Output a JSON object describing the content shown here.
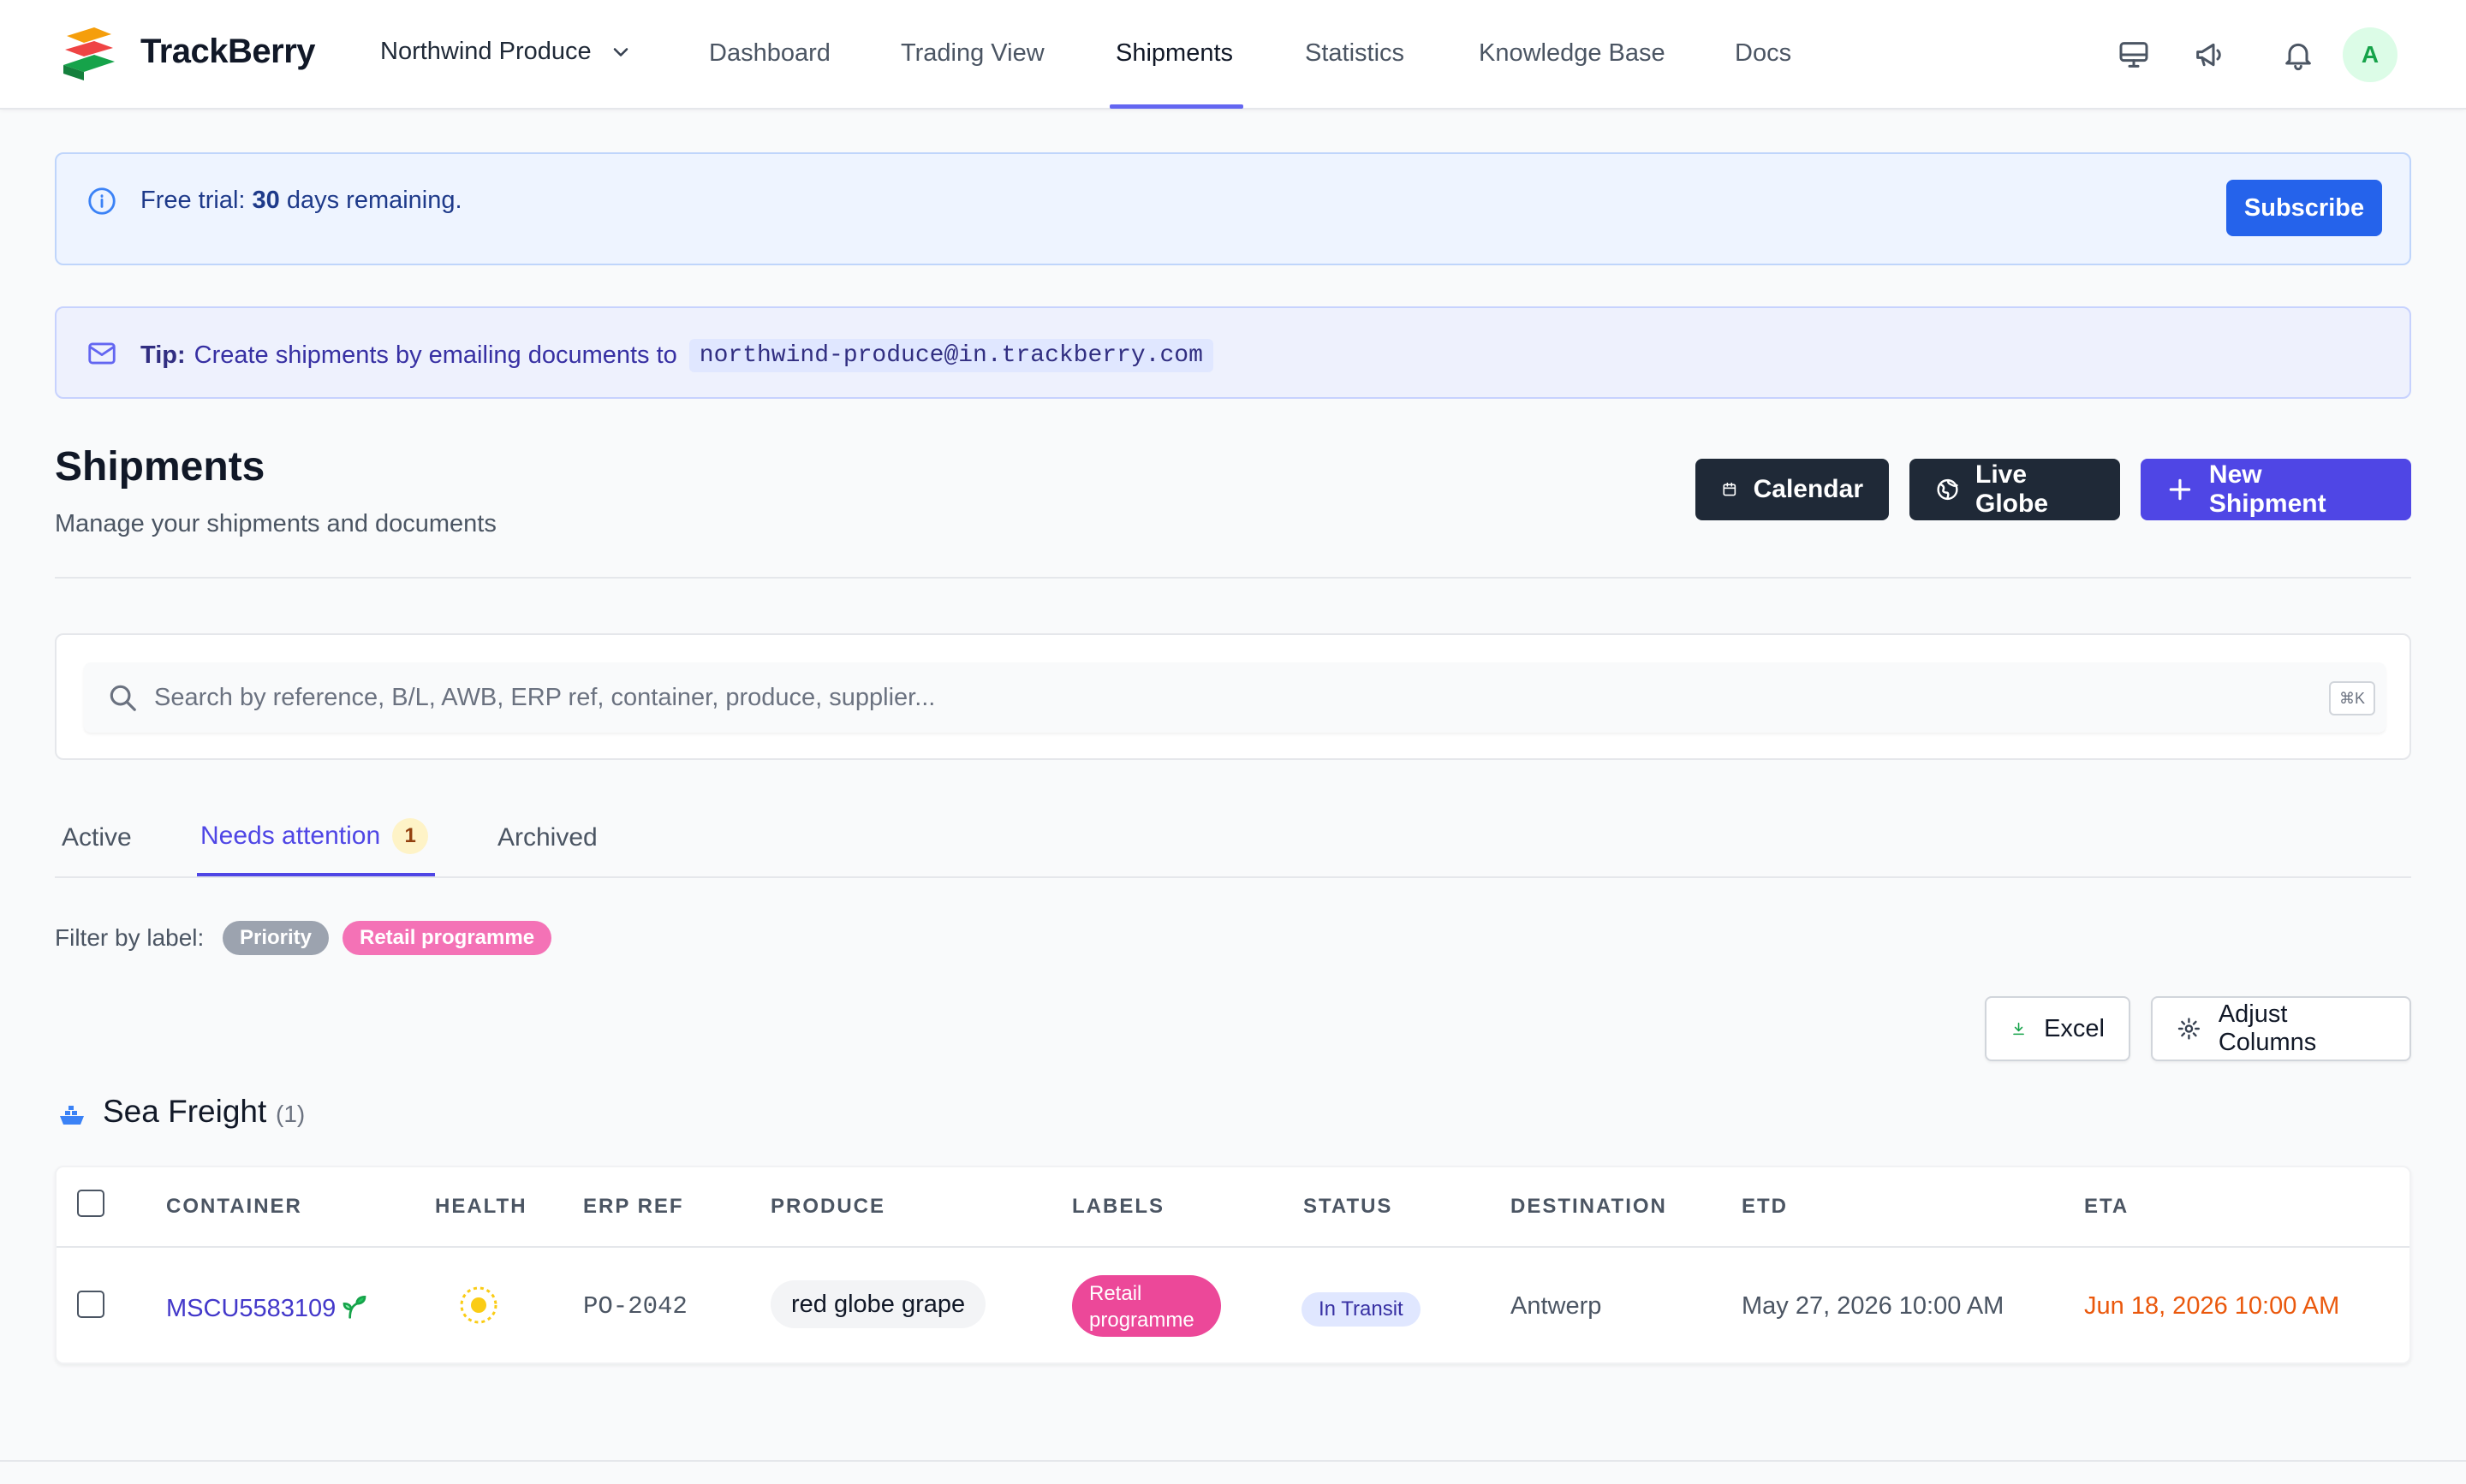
{
  "brand": {
    "name": "TrackBerry"
  },
  "org_switcher": {
    "name": "Northwind Produce"
  },
  "nav": {
    "items": [
      "Dashboard",
      "Trading View",
      "Shipments",
      "Statistics",
      "Knowledge Base",
      "Docs"
    ],
    "active": "Shipments"
  },
  "user": {
    "avatar_initial": "A"
  },
  "trial_banner": {
    "prefix": "Free trial: ",
    "days": "30",
    "suffix": " days remaining.",
    "button": "Subscribe"
  },
  "tip_banner": {
    "label": "Tip:",
    "text": "Create shipments by emailing documents to",
    "email": "northwind-produce@in.trackberry.com"
  },
  "page": {
    "title": "Shipments",
    "subtitle": "Manage your shipments and documents"
  },
  "actions": {
    "calendar": "Calendar",
    "live_globe": "Live Globe",
    "new_shipment": "New Shipment"
  },
  "search": {
    "placeholder": "Search by reference, B/L, AWB, ERP ref, container, produce, supplier...",
    "shortcut": "⌘K"
  },
  "tabs": [
    {
      "label": "Active"
    },
    {
      "label": "Needs attention",
      "badge": "1"
    },
    {
      "label": "Archived"
    }
  ],
  "filter": {
    "label": "Filter by label:",
    "chips": [
      "Priority",
      "Retail programme"
    ]
  },
  "tools": {
    "excel": "Excel",
    "adjust_columns": "Adjust Columns"
  },
  "group": {
    "title": "Sea Freight",
    "count": "(1)"
  },
  "table": {
    "columns": [
      "CONTAINER",
      "HEALTH",
      "ERP REF",
      "PRODUCE",
      "LABELS",
      "STATUS",
      "DESTINATION",
      "ETD",
      "ETA"
    ],
    "rows": [
      {
        "container": "MSCU5583109",
        "erp_ref": "PO-2042",
        "produce": "red globe grape",
        "label": "Retail programme",
        "status": "In Transit",
        "destination": "Antwerp",
        "etd": "May 27, 2026 10:00 AM",
        "eta": "Jun 18, 2026 10:00 AM"
      }
    ]
  },
  "colors": {
    "accent": "#4f46e5",
    "subscribe": "#2563eb",
    "label_pink": "#ec4899",
    "eta_orange": "#ea580c",
    "health_yellow": "#facc15"
  }
}
